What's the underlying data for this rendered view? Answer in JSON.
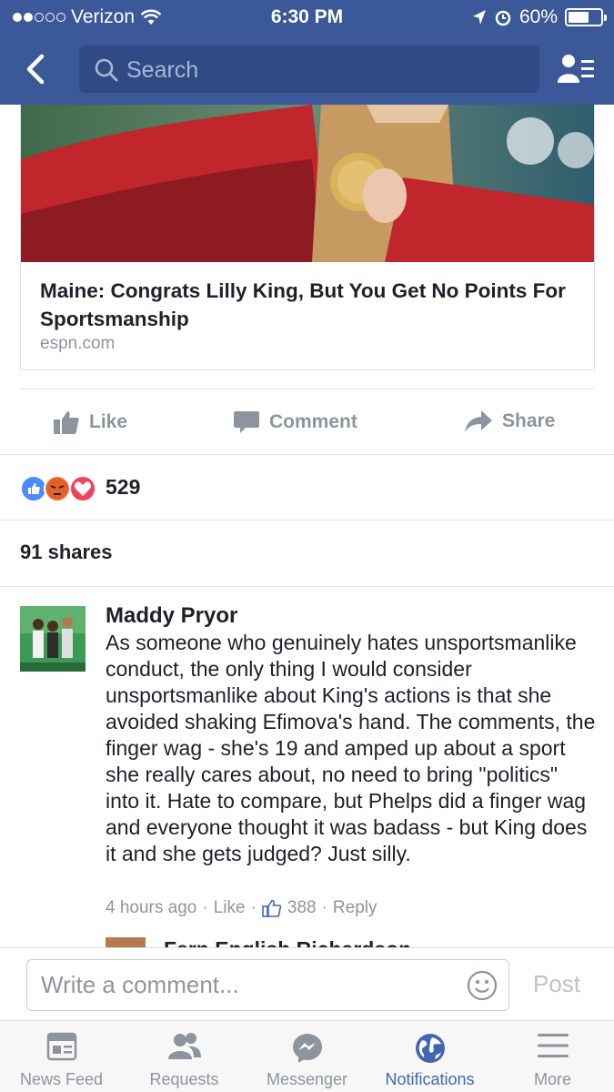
{
  "status_bar": {
    "carrier": "Verizon",
    "time": "6:30 PM",
    "battery": "60%"
  },
  "header": {
    "search_placeholder": "Search"
  },
  "article": {
    "title": "Maine: Congrats Lilly King, But You Get No Points For Sportsmanship",
    "source": "espn.com"
  },
  "actions": {
    "like": "Like",
    "comment": "Comment",
    "share": "Share"
  },
  "reactions": {
    "count": "529",
    "types": [
      "like",
      "angry",
      "love"
    ]
  },
  "shares": "91 shares",
  "comment": {
    "author": "Maddy Pryor",
    "text": "As someone who genuinely hates unsportsmanlike conduct, the only thing I would consider unsportsmanlike about King's actions is that she avoided shaking Efimova's hand. The comments, the finger wag - she's 19 and amped up about a sport she really cares about, no need to bring \"politics\" into it. Hate to compare, but Phelps did a finger wag and everyone thought it was badass - but King does it and she gets judged? Just silly.",
    "time": "4 hours ago",
    "like": "Like",
    "likes_count": "388",
    "reply": "Reply"
  },
  "next_reply": {
    "author": "Fern English Richardson"
  },
  "composer": {
    "placeholder": "Write a comment...",
    "post": "Post"
  },
  "tabs": [
    {
      "label": "News Feed",
      "icon": "news-feed-icon"
    },
    {
      "label": "Requests",
      "icon": "friend-requests-icon"
    },
    {
      "label": "Messenger",
      "icon": "messenger-icon"
    },
    {
      "label": "Notifications",
      "icon": "globe-icon",
      "active": true
    },
    {
      "label": "More",
      "icon": "menu-icon"
    }
  ],
  "colors": {
    "brand": "#3b5998",
    "active_tab": "#4267b2",
    "muted": "#90949c"
  }
}
